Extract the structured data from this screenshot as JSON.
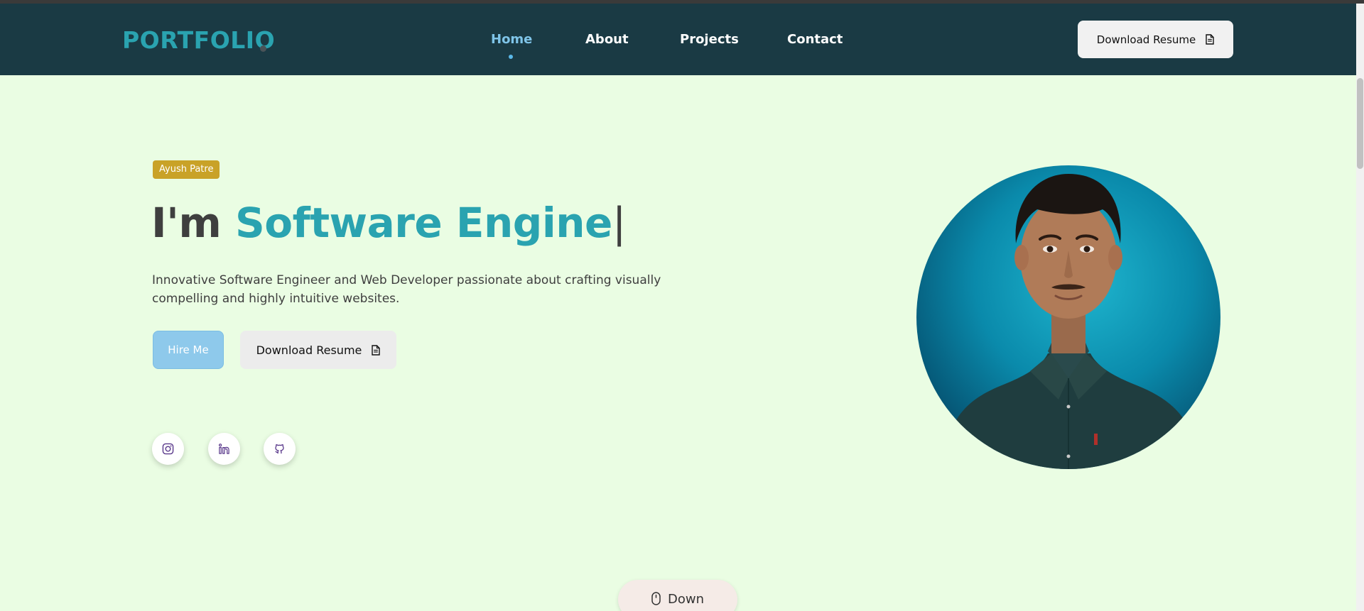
{
  "nav": {
    "logo": "PORTFOLIO",
    "items": [
      {
        "label": "Home",
        "active": true
      },
      {
        "label": "About",
        "active": false
      },
      {
        "label": "Projects",
        "active": false
      },
      {
        "label": "Contact",
        "active": false
      }
    ],
    "resume_label": "Download Resume"
  },
  "hero": {
    "badge": "Ayush Patre",
    "headline_prefix": "I'm ",
    "headline_role": "Software Engine",
    "headline_cursor": "|",
    "tagline": "Innovative Software Engineer and Web Developer passionate about crafting visually compelling and highly intuitive websites.",
    "hire_label": "Hire Me",
    "resume_label": "Download Resume"
  },
  "social": [
    {
      "name": "instagram-icon"
    },
    {
      "name": "linkedin-icon"
    },
    {
      "name": "github-icon"
    }
  ],
  "scroll": {
    "label": "Down"
  },
  "colors": {
    "navbar": "#1a3a44",
    "accent": "#2aa3b0",
    "background": "#eafde3",
    "badge": "#c9a227",
    "hire": "#8ec9eb",
    "icon": "#5b3a8c"
  }
}
